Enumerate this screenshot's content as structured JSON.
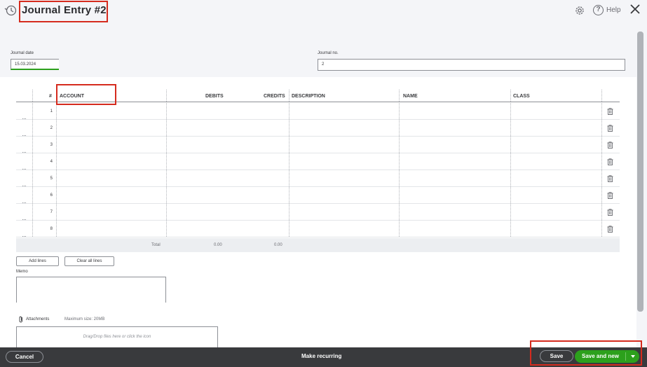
{
  "header": {
    "title": "Journal Entry #2",
    "help_label": "Help"
  },
  "form": {
    "date_label": "Journal date",
    "date_value": "15.03.2024",
    "journal_no_label": "Journal no.",
    "journal_no_value": "2"
  },
  "table": {
    "columns": [
      "#",
      "ACCOUNT",
      "DEBITS",
      "CREDITS",
      "DESCRIPTION",
      "NAME",
      "CLASS"
    ],
    "rows": [
      "1",
      "2",
      "3",
      "4",
      "5",
      "6",
      "7",
      "8"
    ],
    "total_label": "Total",
    "total_debits": "0.00",
    "total_credits": "0.00"
  },
  "actions": {
    "add_lines": "Add lines",
    "clear_all_lines": "Clear all lines"
  },
  "memo": {
    "label": "Memo"
  },
  "attachments": {
    "label": "Attachments",
    "max_size": "Maximum size: 20MB",
    "drop_hint": "Drag/Drop files here or click the icon"
  },
  "footer": {
    "cancel": "Cancel",
    "make_recurring": "Make recurring",
    "save": "Save",
    "save_and_new": "Save and new"
  },
  "colors": {
    "accent_green": "#2ca01c",
    "highlight_red": "#d52b1e",
    "footer_bg": "#393a3d"
  }
}
